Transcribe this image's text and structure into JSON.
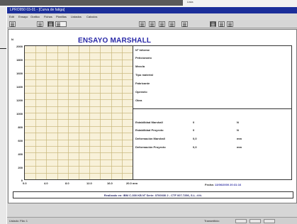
{
  "desktop": {
    "top_label": "Lista"
  },
  "window": {
    "title": "LPRO950 03-01 - [Curva de fatiga]"
  },
  "menu": [
    "Edit",
    "Ensayo",
    "Grafico",
    "Fichas",
    "Planillas",
    "Listados",
    "Calculos"
  ],
  "toolbar": {
    "icons": [
      "exit-icon",
      "grid-icon",
      "zoom-icon",
      "chart-icon",
      "preview-icon",
      "print-icon",
      "page-icon",
      "copy-icon",
      "tool-icon",
      "save-icon",
      "settings-icon",
      "help-icon"
    ]
  },
  "sheet": {
    "title": "ENSAYO MARSHALL",
    "unit": "N",
    "fields": [
      "Nº Informe",
      "Peticionario",
      "Mezcla",
      "Tipo material",
      "Fabricante",
      "Operario",
      "Obra"
    ],
    "results": [
      {
        "label": "Estabilidad Marshall",
        "value": "0",
        "unit": "N"
      },
      {
        "label": "Estabilidad Proyecto",
        "value": "0",
        "unit": "N"
      },
      {
        "label": "Deformación Marshall",
        "value": "0,0",
        "unit": "mm"
      },
      {
        "label": "Deformación Proyecto",
        "value": "0,0",
        "unit": "mm"
      }
    ],
    "date_label": "Fecha:",
    "date_value": "13/06/2000 20:31:16",
    "footer": "Realizado en: IBM C-300 KB Nº Serie: 0700030 2 - CTF 007.7256, S.L.   ###."
  },
  "chart_data": {
    "type": "line",
    "title": "ENSAYO MARSHALL",
    "xlabel": "",
    "ylabel": "N",
    "xlim": [
      0,
      20
    ],
    "ylim": [
      0,
      2000
    ],
    "x_ticks": [
      "0.0",
      "4.0",
      "8.0",
      "12.0",
      "16.0",
      "20.0 mm"
    ],
    "y_ticks": [
      "2000",
      "1800",
      "1600",
      "1400",
      "1200",
      "1000",
      "800",
      "600",
      "400",
      "200",
      "0"
    ],
    "grid": true,
    "series": []
  },
  "status": {
    "left": "Listado: Fila: 1",
    "right": "Transmitido:",
    "boxes": [
      "",
      "",
      ""
    ]
  }
}
